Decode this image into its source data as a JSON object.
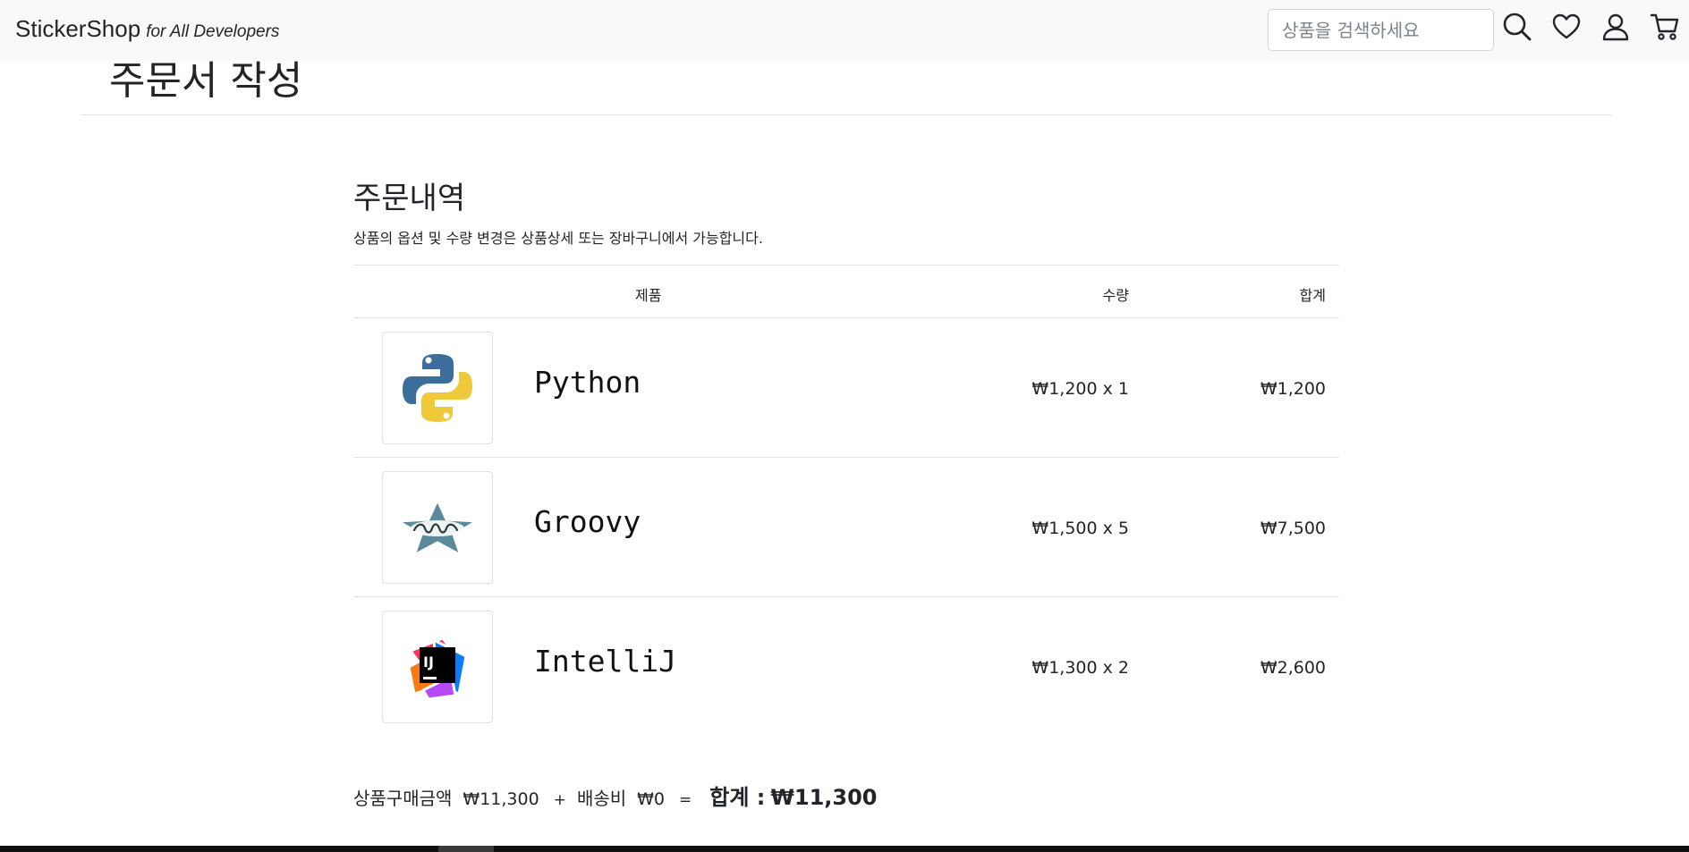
{
  "navbar": {
    "brand_name": "StickerShop",
    "brand_tagline": "for All Developers",
    "search_placeholder": "상품을 검색하세요",
    "icons": [
      "search-icon",
      "heart-icon",
      "user-icon",
      "cart-icon"
    ]
  },
  "page": {
    "title": "주문서 작성"
  },
  "order": {
    "section_title": "주문내역",
    "description": "상품의 옵션 및 수량 변경은 상품상세 또는 장바구니에서 가능합니다.",
    "columns": {
      "product": "제품",
      "quantity": "수량",
      "total": "합계"
    },
    "items": [
      {
        "name": "Python",
        "unit_qty": "₩1,200 x 1",
        "total": "₩1,200",
        "icon": "python-logo-icon"
      },
      {
        "name": "Groovy",
        "unit_qty": "₩1,500 x 5",
        "total": "₩7,500",
        "icon": "groovy-logo-icon"
      },
      {
        "name": "IntelliJ",
        "unit_qty": "₩1,300 x 2",
        "total": "₩2,600",
        "icon": "intellij-logo-icon"
      }
    ]
  },
  "summary": {
    "subtotal_label": "상품구매금액",
    "subtotal_value": "₩11,300",
    "plus": "+",
    "shipping_label": "배송비",
    "shipping_value": "₩0",
    "equals": "=",
    "total_label": "합계 :",
    "total_value": "₩11,300"
  },
  "colors": {
    "navbar_bg": "#f8f9fa",
    "text": "#212529",
    "divider": "#dee2e6"
  }
}
